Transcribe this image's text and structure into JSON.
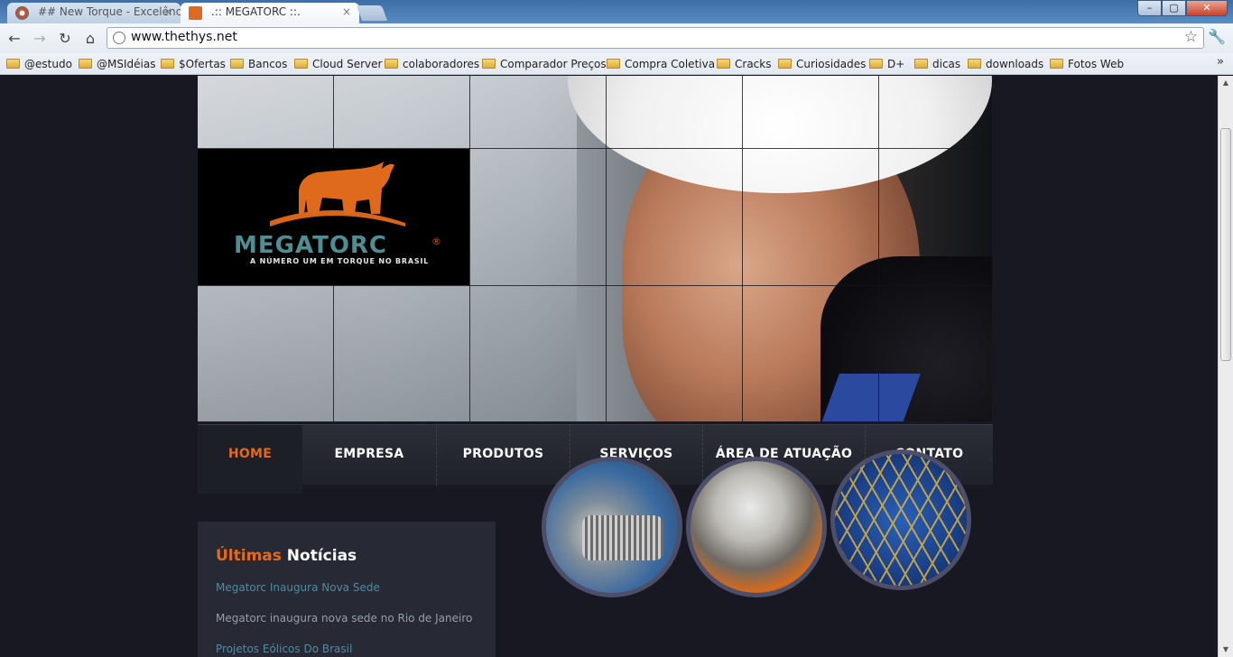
{
  "browser": {
    "tabs": [
      {
        "title": "## New Torque - Excelência",
        "active": false
      },
      {
        "title": ".:: MEGATORC ::.",
        "active": true
      }
    ],
    "tab_close": "×",
    "url": "www.thethys.net",
    "window_buttons": {
      "minimize": "–",
      "maximize": "▢",
      "close": "✕"
    },
    "nav": {
      "back": "←",
      "forward": "→",
      "reload": "↻",
      "home": "⌂"
    },
    "bookmarks": [
      "@estudo",
      "@MSIdéias",
      "$Ofertas",
      "Bancos",
      "Cloud Server",
      "colaboradores",
      "Comparador Preços",
      "Compra Coletiva",
      "Cracks",
      "Curiosidades",
      "D+",
      "dicas",
      "downloads",
      "Fotos Web"
    ],
    "bookmarks_overflow": "»"
  },
  "site": {
    "logo": {
      "name": "MEGATORC",
      "registered": "®",
      "tagline": "A NÚMERO UM EM TORQUE NO BRASIL"
    },
    "nav": [
      {
        "label": "HOME",
        "active": true
      },
      {
        "label": "EMPRESA",
        "active": false
      },
      {
        "label": "PRODUTOS",
        "active": false
      },
      {
        "label": "SERVIÇOS",
        "active": false
      },
      {
        "label": "ÁREA DE ATUAÇÃO",
        "active": false
      },
      {
        "label": "CONTATO",
        "active": false
      }
    ],
    "news": {
      "title_highlight": "Últimas",
      "title_rest": " Notícias",
      "items": [
        {
          "headline": "Megatorc Inaugura Nova Sede",
          "summary": "Megatorc inaugura nova sede no Rio de Janeiro"
        },
        {
          "headline": "Projetos Eólicos Do Brasil"
        }
      ]
    },
    "accent_color": "#e36a16",
    "teal_color": "#4f8f93",
    "featured_images": [
      "turbine-photo",
      "propeller-photo",
      "wind-tower-photo"
    ]
  }
}
